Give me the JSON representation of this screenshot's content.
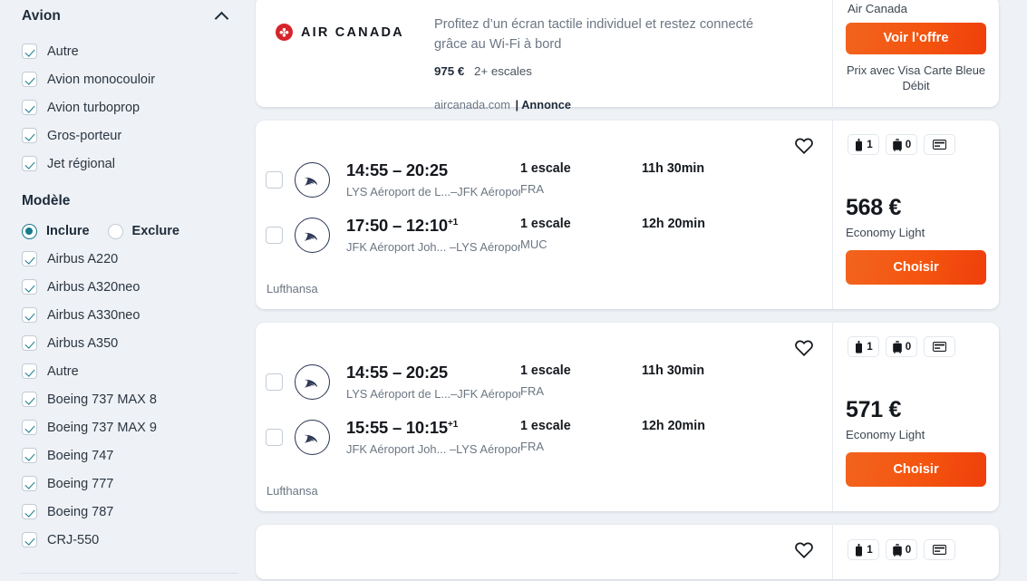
{
  "sidebar": {
    "aircraft": {
      "title": "Avion",
      "collapse_icon": "chevron-up-icon",
      "options": [
        {
          "label": "Autre",
          "checked": true
        },
        {
          "label": "Avion monocouloir",
          "checked": true
        },
        {
          "label": "Avion turboprop",
          "checked": true
        },
        {
          "label": "Gros-porteur",
          "checked": true
        },
        {
          "label": "Jet régional",
          "checked": true
        }
      ]
    },
    "model": {
      "title": "Modèle",
      "mode_include": "Inclure",
      "mode_exclude": "Exclure",
      "mode_selected": "Inclure",
      "options": [
        {
          "label": "Airbus A220",
          "checked": true
        },
        {
          "label": "Airbus A320neo",
          "checked": true
        },
        {
          "label": "Airbus A330neo",
          "checked": true
        },
        {
          "label": "Airbus A350",
          "checked": true
        },
        {
          "label": "Autre",
          "checked": true
        },
        {
          "label": "Boeing 737 MAX 8",
          "checked": true
        },
        {
          "label": "Boeing 737 MAX 9",
          "checked": true
        },
        {
          "label": "Boeing 747",
          "checked": true
        },
        {
          "label": "Boeing 777",
          "checked": true
        },
        {
          "label": "Boeing 787",
          "checked": true
        },
        {
          "label": "CRJ-550",
          "checked": true
        }
      ]
    }
  },
  "ad": {
    "logo_icon": "air-canada-logo",
    "brand": "AIR CANADA",
    "headline": "Profitez d’un écran tactile individuel et restez connecté grâce au Wi-Fi à bord",
    "price": "975 €",
    "stops": "2+ escales",
    "source": "aircanada.com",
    "separator": "|",
    "label": "Annonce",
    "airline": "Air Canada",
    "cta": "Voir l’offre",
    "note": "Prix avec Visa Carte Bleue Débit"
  },
  "results": [
    {
      "favorite_icon": "heart-icon",
      "airline": "Lufthansa",
      "airline_logo_icon": "lufthansa-crane-icon",
      "legs": [
        {
          "time": "14:55 – 20:25",
          "day_offset": "",
          "route": "LYS Aéroport de L...–JFK Aéroport Joh...",
          "stops": "1 escale",
          "via": "FRA",
          "duration": "11h 30min"
        },
        {
          "time": "17:50 – 12:10",
          "day_offset": "+1",
          "route": "JFK Aéroport Joh...  –LYS Aéroport de L...",
          "stops": "1 escale",
          "via": "MUC",
          "duration": "12h 20min"
        }
      ],
      "bags": [
        {
          "icon": "personal-item-icon",
          "count": "1"
        },
        {
          "icon": "carry-on-bag-icon",
          "count": "0"
        },
        {
          "icon": "credit-card-icon",
          "count": ""
        }
      ],
      "price": "568 €",
      "fare": "Economy Light",
      "cta": "Choisir"
    },
    {
      "favorite_icon": "heart-icon",
      "airline": "Lufthansa",
      "airline_logo_icon": "lufthansa-crane-icon",
      "legs": [
        {
          "time": "14:55 – 20:25",
          "day_offset": "",
          "route": "LYS Aéroport de L...–JFK Aéroport Joh...",
          "stops": "1 escale",
          "via": "FRA",
          "duration": "11h 30min"
        },
        {
          "time": "15:55 – 10:15",
          "day_offset": "+1",
          "route": "JFK Aéroport Joh...  –LYS Aéroport de L...",
          "stops": "1 escale",
          "via": "FRA",
          "duration": "12h 20min"
        }
      ],
      "bags": [
        {
          "icon": "personal-item-icon",
          "count": "1"
        },
        {
          "icon": "carry-on-bag-icon",
          "count": "0"
        },
        {
          "icon": "credit-card-icon",
          "count": ""
        }
      ],
      "price": "571 €",
      "fare": "Economy Light",
      "cta": "Choisir"
    }
  ],
  "partial_result": {
    "favorite_icon": "heart-icon",
    "bags": [
      {
        "icon": "personal-item-icon",
        "count": "1"
      },
      {
        "icon": "carry-on-bag-icon",
        "count": "0"
      },
      {
        "icon": "credit-card-icon",
        "count": ""
      }
    ]
  },
  "colors": {
    "accent_orange": "#f2540f",
    "teal": "#177b8a",
    "page_bg": "#eef1f5",
    "lufthansa_navy": "#2a3554",
    "air_canada_red": "#d8232a"
  }
}
